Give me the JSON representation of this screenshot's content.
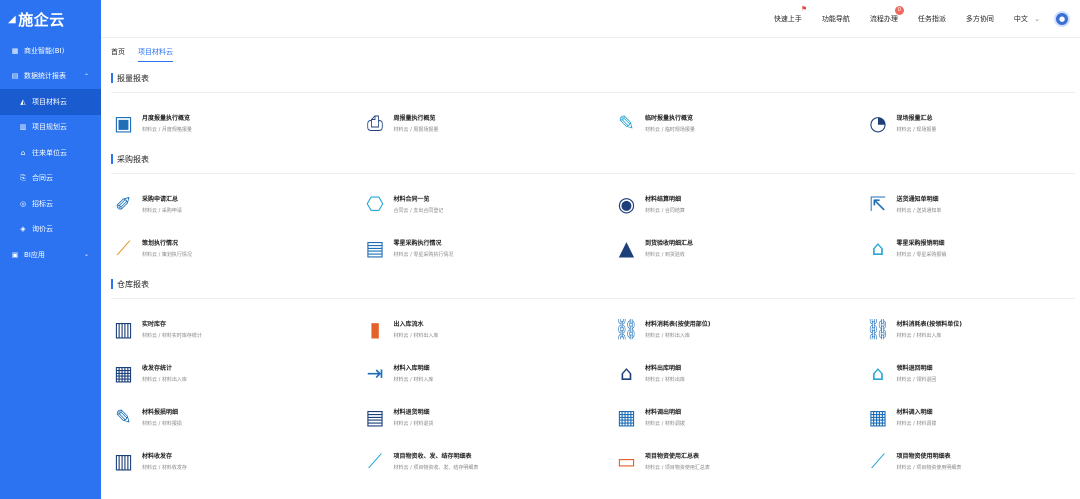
{
  "app": {
    "logo": "施企云"
  },
  "sidebar": {
    "items": [
      {
        "label": "商业智能(BI)",
        "icon": "grid-icon"
      },
      {
        "label": "数据统计报表",
        "icon": "report-icon"
      },
      {
        "label": "项目材料云",
        "icon": "chart-icon"
      },
      {
        "label": "项目规划云",
        "icon": "table-icon"
      },
      {
        "label": "往来单位云",
        "icon": "org-icon"
      },
      {
        "label": "合同云",
        "icon": "contract-icon"
      },
      {
        "label": "招标云",
        "icon": "bid-icon"
      },
      {
        "label": "询价云",
        "icon": "price-icon"
      },
      {
        "label": "BI应用",
        "icon": "app-icon"
      }
    ]
  },
  "topbar": {
    "quick_start": "快速上手",
    "function_nav": "功能导航",
    "process": "流程办理",
    "process_badge": "0",
    "task_guide": "任务指派",
    "multi_collab": "多方协同",
    "lang": "中文"
  },
  "tabs": [
    "首页",
    "项目材料云"
  ],
  "sections": [
    {
      "title": "报量报表",
      "cards": [
        {
          "title": "月度报量执行概览",
          "sub": "材料云 / 月度规格报量"
        },
        {
          "title": "周报量执行概览",
          "sub": "材料云 / 周报场报量"
        },
        {
          "title": "临时报量执行概览",
          "sub": "材料云 / 临时规场报量"
        },
        {
          "title": "现场报量汇总",
          "sub": "材料云 / 现场报量"
        }
      ]
    },
    {
      "title": "采购报表",
      "cards": [
        {
          "title": "采购申请汇总",
          "sub": "材料云 / 采购申请"
        },
        {
          "title": "材料合同一览",
          "sub": "合同云 / 支出合同登记"
        },
        {
          "title": "材料结算明细",
          "sub": "材料云 / 合同结算"
        },
        {
          "title": "送货通知单明细",
          "sub": "材料云 / 送货通知单"
        },
        {
          "title": "策划执行情况",
          "sub": "材料云 / 策划执行情况"
        },
        {
          "title": "零星采购执行情况",
          "sub": "材料云 / 零星采购执行情况"
        },
        {
          "title": "到货验收明细汇总",
          "sub": "材料云 / 到货验收"
        },
        {
          "title": "零星采购报销明细",
          "sub": "材料云 / 零星采购报销"
        }
      ]
    },
    {
      "title": "仓库报表",
      "cards": [
        {
          "title": "实时库存",
          "sub": "材料云 / 材料实时库存统计"
        },
        {
          "title": "出入库流水",
          "sub": "材料云 / 材料出入库"
        },
        {
          "title": "材料消耗表(按使用部位)",
          "sub": "材料云 / 材料出入库"
        },
        {
          "title": "材料消耗表(按领料单位)",
          "sub": "材料云 / 材料出入库"
        },
        {
          "title": "收发存统计",
          "sub": "材料云 / 材料出入库"
        },
        {
          "title": "材料入库明细",
          "sub": "材料云 / 材料入库"
        },
        {
          "title": "材料出库明细",
          "sub": "材料云 / 材料出库"
        },
        {
          "title": "领料退回明细",
          "sub": "材料云 / 领料退回"
        },
        {
          "title": "材料报损明细",
          "sub": "材料云 / 材料报损"
        },
        {
          "title": "材料退货明细",
          "sub": "材料云 / 材料退货"
        },
        {
          "title": "材料调出明细",
          "sub": "材料云 / 材料调拨"
        },
        {
          "title": "材料调入明细",
          "sub": "材料云 / 材料调拨"
        },
        {
          "title": "材料收发存",
          "sub": "材料云 / 材料收发存"
        },
        {
          "title": "项目物资收、发、结存明细表",
          "sub": "材料云 / 项目物资收、发、结存明细表"
        },
        {
          "title": "项目物资使用汇总表",
          "sub": "材料云 / 项目物资使用汇总表"
        },
        {
          "title": "项目物资使用明细表",
          "sub": "材料云 / 项目物资使用明细表"
        }
      ]
    }
  ],
  "colors": {
    "accent": "#2b73f1",
    "sidebar": "#2b73f1",
    "sidebar_active": "#1a5bd0",
    "icon_blue": "#1f6fb8",
    "icon_navy": "#1d3f7a",
    "icon_cyan": "#2aa7d6"
  }
}
